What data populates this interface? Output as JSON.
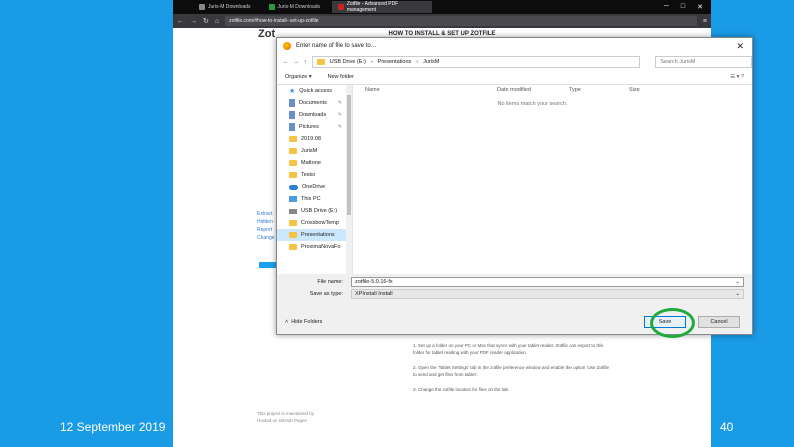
{
  "slide": {
    "date": "12 September 2019",
    "page_number": "40"
  },
  "browser": {
    "tabs": [
      {
        "label": "Juris-M Downloads",
        "active": false,
        "fav_color": "#888888"
      },
      {
        "label": "Juris-M Downloads",
        "active": false,
        "fav_color": "#2b9a3e"
      },
      {
        "label": "Zotfile - Advanced PDF management",
        "active": true,
        "fav_color": "#cc2222"
      }
    ],
    "url": "zotfile.com/#how-to-install--set-up-zotfile",
    "win_min": "─",
    "win_max": "□",
    "win_close": "✕"
  },
  "page": {
    "title": "HOW TO INSTALL & SET UP ZOTFILE",
    "logo": "Zot",
    "side_links": [
      "Extract",
      "Hidden",
      "Report",
      "Change"
    ],
    "body_text": "1. Set up a folder on your PC or Mac that syncs with your tablet reader. Zotfile can export to this folder for tablet reading with your PDF reader application.",
    "step2": "2. Open the 'Tablet Settings' tab in the zotfile preference window and enable the option 'Use Zotfile to send and get files from tablet'.",
    "step3": "3. Change the zotfile location for files on the tab.",
    "foot1": "This project is maintained by",
    "foot2": "Hosted on GitHub Pages"
  },
  "dialog": {
    "title": "Enter name of file to save to…",
    "close": "✕",
    "path": [
      "USB Drive (E:)",
      "Presentations",
      "JurisM"
    ],
    "search_placeholder": "Search JurisM",
    "organize": "Organize ▾",
    "new_folder": "New folder",
    "nav_items": [
      {
        "label": "Quick access",
        "icon": "star",
        "pinned": false,
        "selected": false
      },
      {
        "label": "Documents",
        "icon": "doc",
        "pinned": true,
        "selected": false
      },
      {
        "label": "Downloads",
        "icon": "doc",
        "pinned": true,
        "selected": false
      },
      {
        "label": "Pictures",
        "icon": "doc",
        "pinned": true,
        "selected": false
      },
      {
        "label": "2019.08",
        "icon": "folder",
        "pinned": false,
        "selected": false
      },
      {
        "label": "JurisM",
        "icon": "folder",
        "pinned": false,
        "selected": false
      },
      {
        "label": "Mattone",
        "icon": "folder",
        "pinned": false,
        "selected": false
      },
      {
        "label": "Tesko",
        "icon": "folder",
        "pinned": false,
        "selected": false
      },
      {
        "label": "OneDrive",
        "icon": "cloud",
        "pinned": false,
        "selected": false
      },
      {
        "label": "This PC",
        "icon": "pc",
        "pinned": false,
        "selected": false
      },
      {
        "label": "USB Drive (E:)",
        "icon": "drive",
        "pinned": false,
        "selected": false
      },
      {
        "label": "CrossbowTemp",
        "icon": "folder",
        "pinned": false,
        "selected": false
      },
      {
        "label": "Presentations",
        "icon": "folder",
        "pinned": false,
        "selected": true
      },
      {
        "label": "ProximaNovaFo",
        "icon": "folder",
        "pinned": false,
        "selected": false
      }
    ],
    "columns": {
      "name": "Name",
      "date": "Date modified",
      "type": "Type",
      "size": "Size"
    },
    "empty_message": "No items match your search.",
    "file_name_label": "File name:",
    "file_name_value": "zotfile-5.0.16-fx",
    "save_type_label": "Save as type:",
    "save_type_value": "XPInstall Install",
    "hide_folders": "Hide Folders",
    "save": "Save",
    "cancel": "Cancel"
  },
  "colors": {
    "background": "#1a9be6",
    "highlight": "#1faa3c"
  }
}
